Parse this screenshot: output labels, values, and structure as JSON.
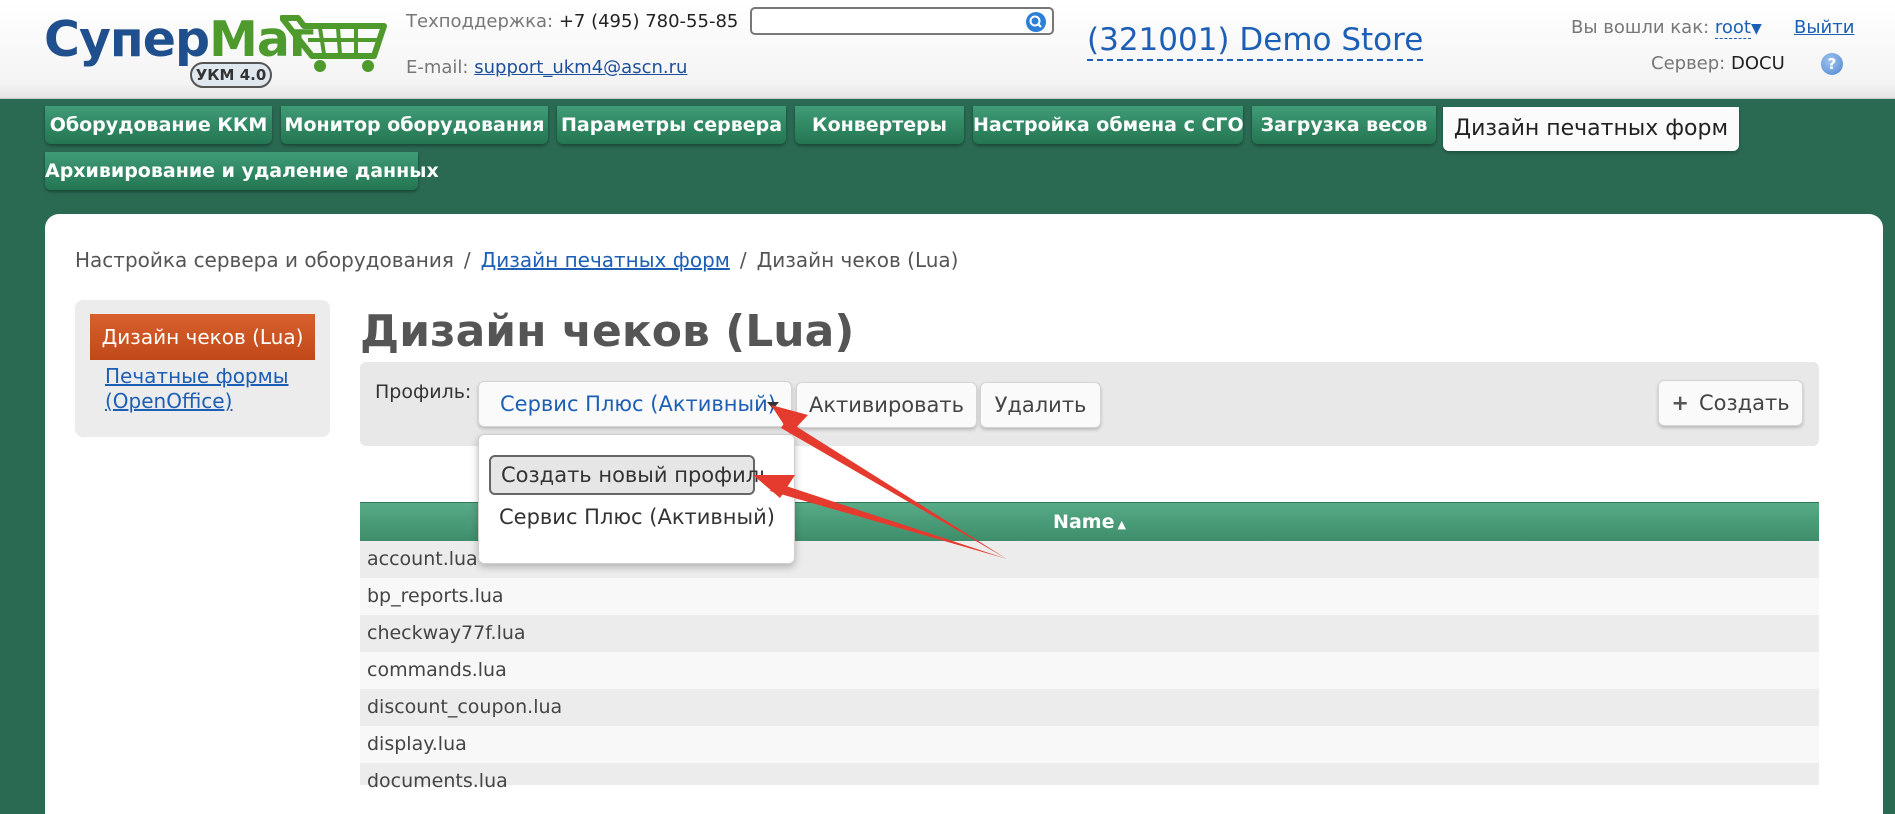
{
  "brand": {
    "logo_part1": "Супер",
    "logo_part2": "Маг",
    "version_badge": "УКМ 4.0"
  },
  "header": {
    "support_label": "Техподдержка:",
    "support_phone": "+7 (495) 780-55-85",
    "email_label": "E-mail:",
    "email": "support_ukm4@ascn.ru",
    "search_placeholder": "",
    "store_name": "(321001) Demo Store",
    "logged_in_label": "Вы вошли как:",
    "user": "root",
    "logout": "Выйти",
    "server_label": "Сервер:",
    "server_name": "DOCU",
    "help_icon": "?"
  },
  "tabs": [
    {
      "label": "Оборудование ККМ"
    },
    {
      "label": "Монитор оборудования"
    },
    {
      "label": "Параметры сервера"
    },
    {
      "label": "Конвертеры"
    },
    {
      "label": "Настройка обмена с СГО"
    },
    {
      "label": "Загрузка весов"
    },
    {
      "label": "Дизайн печатных форм",
      "active": true
    },
    {
      "label": "Архивирование и удаление данных"
    }
  ],
  "breadcrumb": {
    "root": "Настройка сервера и оборудования",
    "separator": "/",
    "section": "Дизайн печатных форм",
    "current": "Дизайн чеков (Lua)"
  },
  "sidebar": {
    "active": "Дизайн чеков (Lua)",
    "link": "Печатные формы (OpenOffice)"
  },
  "page": {
    "title": "Дизайн чеков (Lua)",
    "profile_label": "Профиль:",
    "profile_value": "Сервис Плюс (Активный)",
    "activate": "Активировать",
    "delete": "Удалить",
    "create_icon": "+",
    "create": "Создать"
  },
  "dropdown": {
    "options": [
      "Создать новый профиль",
      "Сервис Плюс (Активный)"
    ]
  },
  "table": {
    "column": "Name",
    "sort_indicator": "▲",
    "rows": [
      "account.lua",
      "bp_reports.lua",
      "checkway77f.lua",
      "commands.lua",
      "discount_coupon.lua",
      "display.lua",
      "documents.lua"
    ]
  },
  "colors": {
    "background": "#2a6a53",
    "tab": "#2f8560",
    "active_nav": "#c94f1f",
    "link": "#1d5fb5",
    "annotation_arrow": "#e53a2e"
  }
}
